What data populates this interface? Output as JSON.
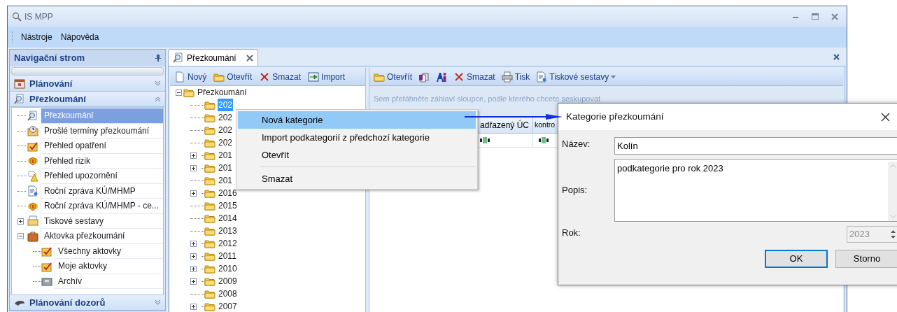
{
  "window": {
    "title": "IS MPP"
  },
  "menu_bar": [
    "Nástroje",
    "Nápověda"
  ],
  "nav_panel": {
    "title": "Navigační strom",
    "groups": [
      {
        "label": "Plánování",
        "expanded": false
      },
      {
        "label": "Přezkoumání",
        "expanded": true,
        "items": [
          {
            "label": "Přezkoumání",
            "selected": true
          },
          {
            "label": "Prošlé termíny přezkoumání",
            "selected": false
          },
          {
            "label": "Přehled opatření",
            "selected": false
          },
          {
            "label": "Přehled rizik",
            "selected": false
          },
          {
            "label": "Přehled upozornění",
            "selected": false
          },
          {
            "label": "Roční zpráva KÚ/MHMP",
            "selected": false
          },
          {
            "label": "Roční zpráva KÚ/MHMP - ce...",
            "selected": false
          },
          {
            "label": "Tiskové sestavy",
            "selected": false,
            "expanded": false
          },
          {
            "label": "Aktovka přezkoumání",
            "selected": false,
            "expanded": true,
            "children": [
              {
                "label": "Všechny aktovky",
                "selected": false
              },
              {
                "label": "Moje aktovky",
                "selected": false
              },
              {
                "label": "Archív",
                "selected": false
              }
            ]
          }
        ]
      },
      {
        "label": "Plánování dozorů",
        "expanded": false
      }
    ]
  },
  "doc_tabs": [
    {
      "label": "Přezkoumání",
      "selected": true
    }
  ],
  "left_pane": {
    "toolbar": [
      "Nový",
      "Otevřít",
      "Smazat",
      "Import"
    ],
    "tree": {
      "label": "Přezkoumání",
      "expanded": true,
      "children": [
        {
          "label": "202",
          "selected": true
        },
        {
          "label": "202",
          "selected": false
        },
        {
          "label": "202",
          "selected": false
        },
        {
          "label": "202",
          "selected": false
        },
        {
          "label": "201",
          "selected": false,
          "expanded": false
        },
        {
          "label": "201",
          "selected": false,
          "expanded": false
        },
        {
          "label": "201",
          "selected": false
        },
        {
          "label": "2016",
          "selected": false,
          "expanded": false
        },
        {
          "label": "2015",
          "selected": false
        },
        {
          "label": "2014",
          "selected": false
        },
        {
          "label": "2013",
          "selected": false
        },
        {
          "label": "2012",
          "selected": false,
          "expanded": false
        },
        {
          "label": "2011",
          "selected": false,
          "expanded": false
        },
        {
          "label": "2010",
          "selected": false,
          "expanded": false
        },
        {
          "label": "2009",
          "selected": false,
          "expanded": false
        },
        {
          "label": "2008",
          "selected": false
        },
        {
          "label": "2007",
          "selected": false,
          "expanded": false
        }
      ]
    }
  },
  "right_pane": {
    "toolbar": [
      {
        "kind": "button",
        "label": "Otevřít"
      },
      {
        "kind": "icon_button"
      },
      {
        "kind": "icon_button"
      },
      {
        "kind": "button",
        "label": "Smazat"
      },
      {
        "kind": "button",
        "label": "Tisk"
      },
      {
        "kind": "dropdown",
        "label": "Tiskové sestavy"
      }
    ],
    "group_hint": "Sem přetáhněte záhlaví sloupce, podle kterého chcete seskupovat",
    "grid": {
      "columns": [
        "adřazený ÚC",
        "kontro"
      ]
    }
  },
  "context_menu": [
    {
      "kind": "item",
      "label": "Nová kategorie",
      "selected": true
    },
    {
      "kind": "item",
      "label": "Import podkategorií z předchozí kategorie",
      "selected": false
    },
    {
      "kind": "item",
      "label": "Otevřít",
      "selected": false
    },
    {
      "kind": "separator"
    },
    {
      "kind": "item",
      "label": "Smazat",
      "selected": false
    }
  ],
  "dialog": {
    "title": "Kategorie přezkoumání",
    "fields": [
      {
        "kind": "text",
        "label": "Název:",
        "value": "Kolín"
      },
      {
        "kind": "multiline",
        "label": "Popis:",
        "value": "podkategorie pro rok 2023"
      },
      {
        "kind": "spin",
        "label": "Rok:",
        "value": "2023",
        "disabled": true
      }
    ],
    "buttons": [
      {
        "label": "OK",
        "focused": true
      },
      {
        "label": "Storno",
        "focused": false
      }
    ]
  }
}
